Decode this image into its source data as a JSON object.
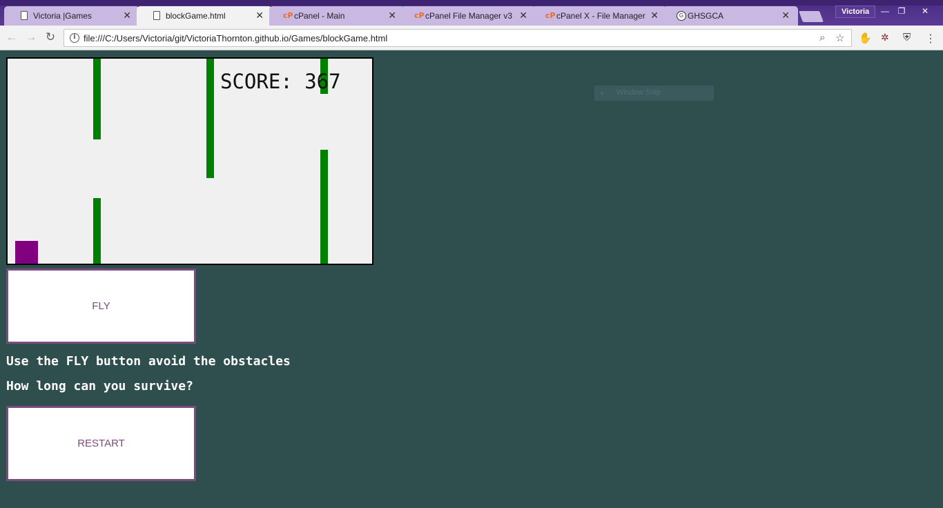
{
  "browser": {
    "tabs": [
      {
        "title": "Victoria |Games",
        "favicon": "document-icon",
        "active": false
      },
      {
        "title": "blockGame.html",
        "favicon": "document-icon",
        "active": true
      },
      {
        "title": "cPanel - Main",
        "favicon": "cpanel-icon",
        "active": false
      },
      {
        "title": "cPanel File Manager v3",
        "favicon": "cpanel-icon",
        "active": false
      },
      {
        "title": "cPanel X - File Manager",
        "favicon": "cpanel-icon",
        "active": false
      },
      {
        "title": "GHSGCA",
        "favicon": "ghsgca-icon",
        "active": false
      }
    ],
    "profile_name": "Victoria",
    "url": "file:///C:/Users/Victoria/git/VictoriaThornton.github.io/Games/blockGame.html"
  },
  "game": {
    "score_text": "SCORE: 367",
    "colors": {
      "canvas_bg": "#f0f0f0",
      "obstacle": "#008000",
      "player": "#800080",
      "page_bg": "#2f4f4f",
      "button_border": "#7b4a80"
    }
  },
  "controls": {
    "fly_label": "FLY",
    "restart_label": "RESTART"
  },
  "instructions": {
    "line1": "Use the FLY button avoid the obstacles",
    "line2": "How long can you survive?"
  },
  "overlay": {
    "window_snip_label": "Window Snip"
  }
}
